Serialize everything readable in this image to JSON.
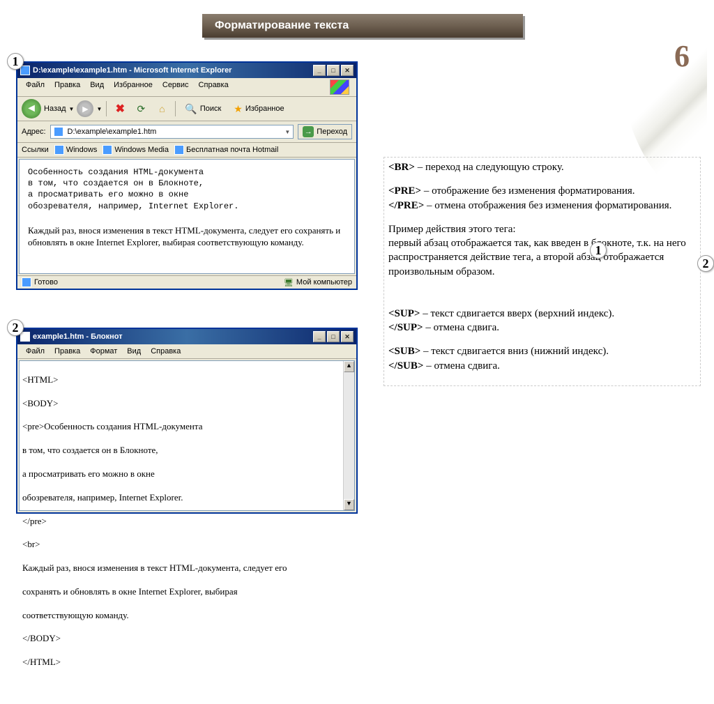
{
  "banner": {
    "title": "Форматирование текста"
  },
  "page_number": "6",
  "callouts": {
    "c1": "1",
    "c2": "2",
    "c3": "1",
    "c4": "2"
  },
  "ie": {
    "title": "D:\\example\\example1.htm - Microsoft Internet Explorer",
    "menu": {
      "file": "Файл",
      "edit": "Правка",
      "view": "Вид",
      "fav": "Избранное",
      "tools": "Сервис",
      "help": "Справка"
    },
    "toolbar": {
      "back": "Назад",
      "search": "Поиск",
      "fav": "Избранное"
    },
    "address_label": "Адрес:",
    "address_value": "D:\\example\\example1.htm",
    "go_label": "Переход",
    "linksbar": {
      "links": "Ссылки",
      "windows": "Windows",
      "wm": "Windows Media",
      "hotmail": "Бесплатная почта Hotmail"
    },
    "content_pre": "Особенность создания HTML-документа\nв том, что создается он в Блокноте,\nа просматривать его можно в окне\nобозревателя, например, Internet Explorer.",
    "content_p": "Каждый раз, внося изменения в текст HTML-документа, следует его сохранять и обновлять в окне Internet Explorer, выбирая соответствующую команду.",
    "status_ready": "Готово",
    "status_zone": "Мой компьютер"
  },
  "notepad": {
    "title": "example1.htm - Блокнот",
    "menu": {
      "file": "Файл",
      "edit": "Правка",
      "format": "Формат",
      "view": "Вид",
      "help": "Справка"
    },
    "lines": {
      "l1": "<HTML>",
      "l2": "<BODY>",
      "l3": "<pre>Особенность создания HTML-документа",
      "l4": "в том, что создается он в Блокноте,",
      "l5": "а просматривать его можно в окне",
      "l6": "обозревателя, например, Internet Explorer.",
      "l7": "</pre>",
      "l8": "<br>",
      "l9": "Каждый раз, внося изменения в текст HTML-документа, следует его",
      "l10": "сохранять и обновлять в окне Internet Explorer, выбирая",
      "l11": "соответствующую команду.",
      "l12": "</BODY>",
      "l13": "</HTML>"
    }
  },
  "explain": {
    "br": {
      "tag": "<BR>",
      "desc": " – переход на следующую строку."
    },
    "pre_open": {
      "tag": "<PRE>",
      "desc": " – отображение без изменения форматирования."
    },
    "pre_close": {
      "tag": "</PRE>",
      "desc": " – отмена отображения без изменения форматирования."
    },
    "example_label": "Пример действия этого тега:",
    "example_body": "первый абзац отображается так, как введен в блокноте, т.к. на него распространяется действие тега, а второй абзац отображается произвольным образом.",
    "sup_open": {
      "tag": "<SUP>",
      "desc": " – текст сдвигается вверх (верхний индекс)."
    },
    "sup_close": {
      "tag": "</SUP>",
      "desc": " – отмена сдвига."
    },
    "sub_open": {
      "tag": "<SUB>",
      "desc": " – текст сдвигается вниз (нижний индекс)."
    },
    "sub_close": {
      "tag": "</SUB>",
      "desc": " – отмена сдвига."
    }
  }
}
